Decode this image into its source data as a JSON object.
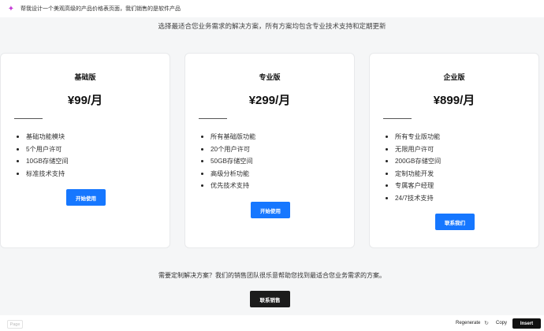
{
  "prompt": {
    "text": "帮我设计一个美观高级的产品价格表页面，我们销售的是软件产品"
  },
  "subtitle": "选择最适合您业务需求的解决方案，所有方案均包含专业技术支持和定期更新",
  "plans": [
    {
      "name": "基础版",
      "price": "¥99/月",
      "features": [
        "基础功能模块",
        "5个用户许可",
        "10GB存储空间",
        "标准技术支持"
      ],
      "button": "开始使用"
    },
    {
      "name": "专业版",
      "price": "¥299/月",
      "features": [
        "所有基础版功能",
        "20个用户许可",
        "50GB存储空间",
        "高级分析功能",
        "优先技术支持"
      ],
      "button": "开始使用"
    },
    {
      "name": "企业版",
      "price": "¥899/月",
      "features": [
        "所有专业版功能",
        "无限用户许可",
        "200GB存储空间",
        "定制功能开发",
        "专属客户经理",
        "24/7技术支持"
      ],
      "button": "联系我们"
    }
  ],
  "footer": {
    "text": "需要定制解决方案？我们的销售团队很乐意帮助您找到最适合您业务需求的方案。",
    "button": "联系销售"
  },
  "bottom_bar": {
    "page": "Page",
    "regenerate": "Regenerate",
    "copy": "Copy",
    "insert": "Insert"
  },
  "colors": {
    "primary": "#1677ff",
    "dark_button": "#1c1c1c",
    "background": "#f5f6f7",
    "prompt_icon": "#c53bd6"
  }
}
